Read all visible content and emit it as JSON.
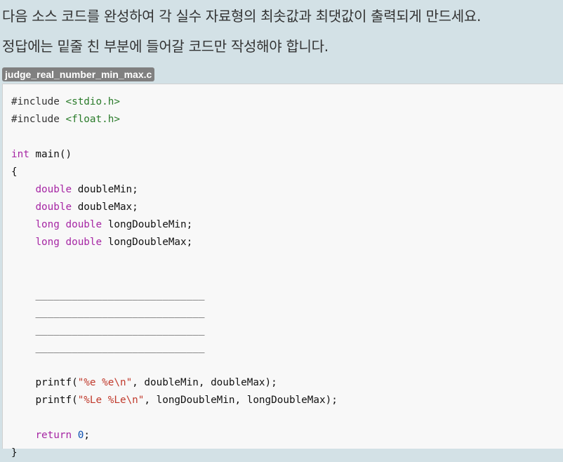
{
  "instructions": {
    "line1": "다음 소스 코드를 완성하여 각 실수 자료형의 최솟값과 최댓값이 출력되게 만드세요.",
    "line2": "정답에는 밑줄 친 부분에 들어갈 코드만 작성해야 합니다."
  },
  "file": {
    "name": "judge_real_number_min_max.c"
  },
  "code": {
    "include1_directive": "#include",
    "include1_header": "<stdio.h>",
    "include2_directive": "#include",
    "include2_header": "<float.h>",
    "main_type": "int",
    "main_sig": " main()",
    "open_brace": "{",
    "decl1_type": "double",
    "decl1_name": " doubleMin;",
    "decl2_type": "double",
    "decl2_name": " doubleMax;",
    "decl3_type1": "long",
    "decl3_type2": "double",
    "decl3_name": " longDoubleMin;",
    "decl4_type1": "long",
    "decl4_type2": "double",
    "decl4_name": " longDoubleMax;",
    "blank": "____________________________",
    "printf1_fn": "printf(",
    "printf1_fmt": "\"%e %e\\n\"",
    "printf1_args": ", doubleMin, doubleMax);",
    "printf2_fn": "printf(",
    "printf2_fmt": "\"%Le %Le\\n\"",
    "printf2_args": ", longDoubleMin, longDoubleMax);",
    "return_kw": "return",
    "return_val": "0",
    "return_end": ";",
    "close_brace": "}"
  }
}
